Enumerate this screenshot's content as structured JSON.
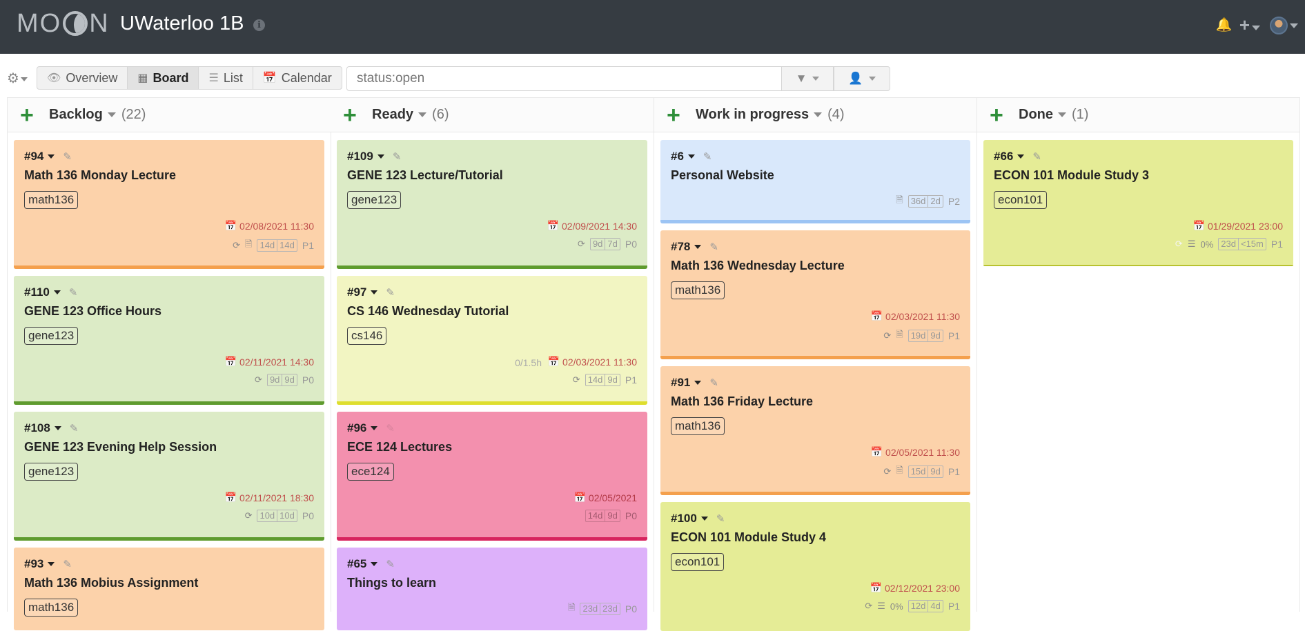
{
  "app": {
    "logo": "MOON",
    "project_title": "UWaterloo 1B"
  },
  "views": [
    {
      "label": "Overview",
      "icon": "eye-icon",
      "active": false
    },
    {
      "label": "Board",
      "icon": "grid-icon",
      "active": true
    },
    {
      "label": "List",
      "icon": "list-icon",
      "active": false
    },
    {
      "label": "Calendar",
      "icon": "calendar-icon",
      "active": false
    }
  ],
  "search": {
    "value": "status:open"
  },
  "columns": [
    {
      "name": "Backlog",
      "count": "(22)"
    },
    {
      "name": "Ready",
      "count": "(6)"
    },
    {
      "name": "Work in progress",
      "count": "(4)"
    },
    {
      "name": "Done",
      "count": "(1)"
    }
  ],
  "cards": {
    "c94": {
      "num": "#94",
      "title": "Math 136 Monday Lecture",
      "tag": "math136",
      "due": "02/08/2021 11:30",
      "t1": "14d",
      "t2": "14d",
      "priority": "P1"
    },
    "c110": {
      "num": "#110",
      "title": "GENE 123 Office Hours",
      "tag": "gene123",
      "due": "02/11/2021 14:30",
      "t1": "9d",
      "t2": "9d",
      "priority": "P0"
    },
    "c108": {
      "num": "#108",
      "title": "GENE 123 Evening Help Session",
      "tag": "gene123",
      "due": "02/11/2021 18:30",
      "t1": "10d",
      "t2": "10d",
      "priority": "P0"
    },
    "c93": {
      "num": "#93",
      "title": "Math 136 Mobius Assignment",
      "tag": "math136"
    },
    "c109": {
      "num": "#109",
      "title": "GENE 123 Lecture/Tutorial",
      "tag": "gene123",
      "due": "02/09/2021 14:30",
      "t1": "9d",
      "t2": "7d",
      "priority": "P0"
    },
    "c97": {
      "num": "#97",
      "title": "CS 146 Wednesday Tutorial",
      "tag": "cs146",
      "estimate": "0/1.5h",
      "due": "02/03/2021 11:30",
      "t1": "14d",
      "t2": "9d",
      "priority": "P1"
    },
    "c96": {
      "num": "#96",
      "title": "ECE 124 Lectures",
      "tag": "ece124",
      "due": "02/05/2021",
      "t1": "14d",
      "t2": "9d",
      "priority": "P0"
    },
    "c65": {
      "num": "#65",
      "title": "Things to learn",
      "t1": "23d",
      "t2": "23d",
      "priority": "P0"
    },
    "c6": {
      "num": "#6",
      "title": "Personal Website",
      "t1": "36d",
      "t2": "2d",
      "priority": "P2"
    },
    "c78": {
      "num": "#78",
      "title": "Math 136 Wednesday Lecture",
      "tag": "math136",
      "due": "02/03/2021 11:30",
      "t1": "19d",
      "t2": "9d",
      "priority": "P1"
    },
    "c91": {
      "num": "#91",
      "title": "Math 136 Friday Lecture",
      "tag": "math136",
      "due": "02/05/2021 11:30",
      "t1": "15d",
      "t2": "9d",
      "priority": "P1"
    },
    "c100": {
      "num": "#100",
      "title": "ECON 101 Module Study 4",
      "tag": "econ101",
      "due": "02/12/2021 23:00",
      "progress": "0%",
      "t1": "12d",
      "t2": "4d",
      "priority": "P1"
    },
    "c66": {
      "num": "#66",
      "title": "ECON 101 Module Study 3",
      "tag": "econ101",
      "due": "01/29/2021 23:00",
      "progress": "0%",
      "t1": "23d",
      "t2": "<15m",
      "priority": "P1"
    }
  }
}
